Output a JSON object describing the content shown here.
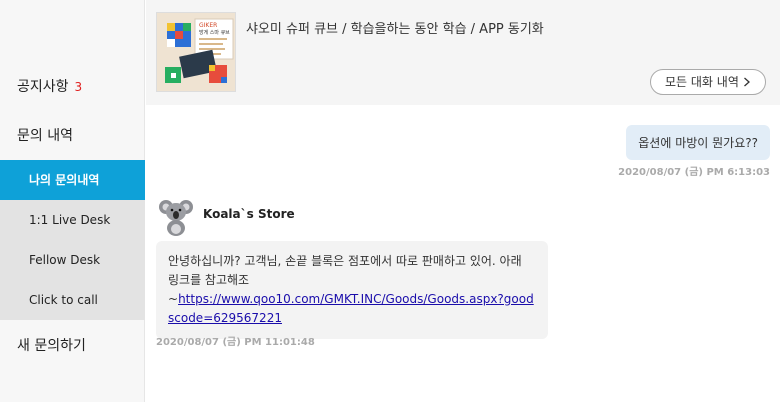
{
  "sidebar": {
    "notice_label": "공지사항",
    "notice_count": "3",
    "inquiry_label": "문의 내역",
    "submenu": [
      {
        "label": "나의 문의내역",
        "active": true
      },
      {
        "label": "1:1 Live Desk",
        "active": false
      },
      {
        "label": "Fellow Desk",
        "active": false
      },
      {
        "label": "Click to call",
        "active": false
      }
    ],
    "new_inquiry_label": "새 문의하기"
  },
  "product": {
    "title": "샤오미 슈퍼 큐브 / 학습을하는 동안 학습 / APP 동기화",
    "all_chats_label": "모든 대화 내역",
    "thumb_brand": "GIKER",
    "thumb_caption": "방게 스마 큐브"
  },
  "chat": {
    "user_message": "옵션에 마방이 뭔가요??",
    "user_timestamp": "2020/08/07 (금) PM 6:13:03",
    "store_name": "Koala`s Store",
    "store_message": "안녕하십니까? 고객님, 손끝 블록은 점포에서 따로 판매하고 있어. 아래 링크를 참고해조",
    "store_link_prefix": "~",
    "store_link": "https://www.qoo10.com/GMKT.INC/Goods/Goods.aspx?goodscode=629567221",
    "store_timestamp": "2020/08/07 (금) PM 11:01:48"
  }
}
